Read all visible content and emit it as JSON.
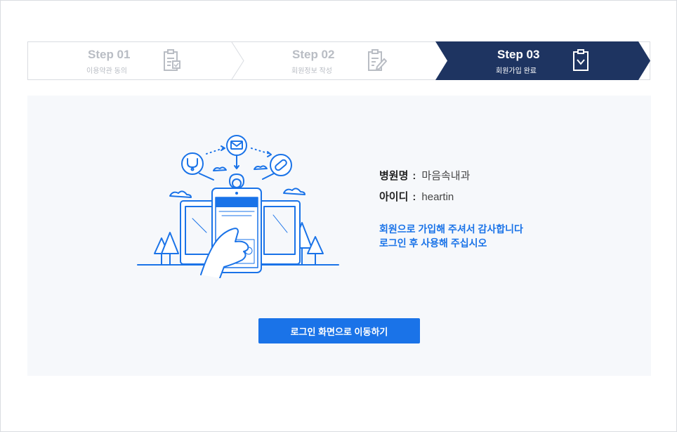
{
  "steps": [
    {
      "title": "Step 01",
      "subtitle": "이용약관 동의",
      "state": "inactive",
      "icon": "clipboard-check-icon"
    },
    {
      "title": "Step 02",
      "subtitle": "회원정보 작성",
      "state": "inactive",
      "icon": "clipboard-pen-icon"
    },
    {
      "title": "Step 03",
      "subtitle": "회원가입 완료",
      "state": "active",
      "icon": "clipboard-done-icon"
    }
  ],
  "info": {
    "hospital_label": "병원명",
    "hospital_value": "마음속내과",
    "id_label": "아이디",
    "id_value": "heartin",
    "colon": ":"
  },
  "message": {
    "line1": "회원으로 가입해 주셔서 감사합니다",
    "line2": "로그인 후 사용해 주십시오"
  },
  "button": {
    "label": "로그인 화면으로 이동하기"
  },
  "colors": {
    "accent": "#1a73e8",
    "active_step": "#1e3461",
    "panel_bg": "#f6f8fb",
    "inactive_text": "#b9bdc4"
  }
}
